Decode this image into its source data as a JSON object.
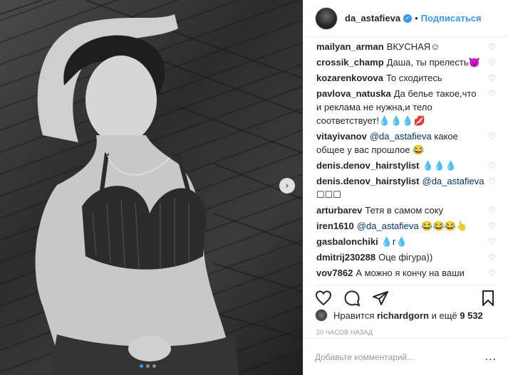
{
  "header": {
    "username": "da_astafieva",
    "separator": "•",
    "follow_label": "Подписаться"
  },
  "photo": {
    "next_arrow": "›",
    "dot_count": 3
  },
  "comments": [
    {
      "user": "mailyan_arman",
      "mention": "",
      "text": "ВКУСНАЯ☺"
    },
    {
      "user": "crossik_champ",
      "mention": "",
      "text": "Даша, ты прелесть😈"
    },
    {
      "user": "kozarenkovova",
      "mention": "",
      "text": "То сходитесь"
    },
    {
      "user": "pavlova_natuska",
      "mention": "",
      "text": "Да белье такое,что и реклама не нужна,и тело соответствует!💧💧💧💋"
    },
    {
      "user": "vitayivanov",
      "mention": "@da_astafieva",
      "text": "какое общее у вас прошлое 😂"
    },
    {
      "user": "denis.denov_hairstylist",
      "mention": "",
      "text": "💧💧💧"
    },
    {
      "user": "denis.denov_hairstylist",
      "mention": "@da_astafieva",
      "text": "☐☐☐"
    },
    {
      "user": "arturbarev",
      "mention": "",
      "text": "Тетя в самом соку"
    },
    {
      "user": "iren1610",
      "mention": "@da_astafieva",
      "text": "😂😂😂👆"
    },
    {
      "user": "gasbalonchiki",
      "mention": "",
      "text": "💧г💧"
    },
    {
      "user": "dmitrij230288",
      "mention": "",
      "text": "Оце фігура))"
    },
    {
      "user": "vov7862",
      "mention": "",
      "text": "А можно я кончу на ваши ножки"
    }
  ],
  "heart_glyph": "♡",
  "likes": {
    "prefix": "Нравится",
    "user": "richardgorn",
    "middle": "и ещё",
    "count": "9 532"
  },
  "time_ago": "20 ЧАСОВ НАЗАД",
  "add_comment": {
    "placeholder": "Добавьте комментарий...",
    "more": "..."
  }
}
